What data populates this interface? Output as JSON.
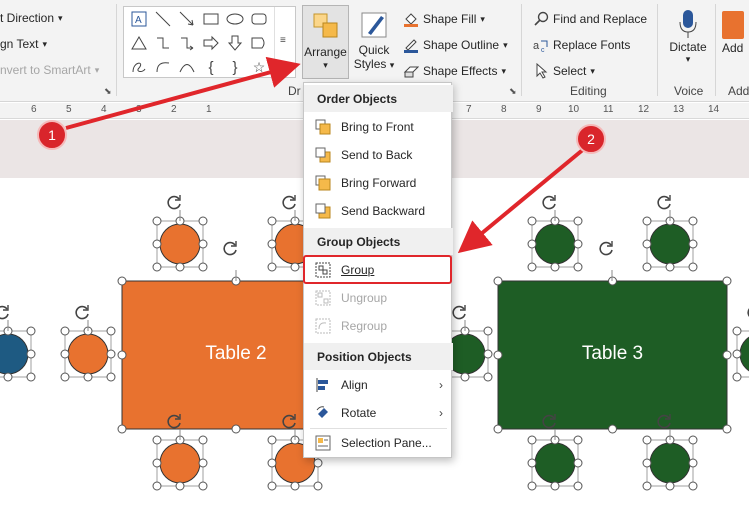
{
  "ribbon": {
    "text_direction": "t Direction",
    "align_text": "gn Text",
    "convert_smartart": "nvert to SmartArt",
    "drawing_group": "Dr",
    "arrange_label": "Arrange",
    "quick_styles_1": "Quick",
    "quick_styles_2": "Styles",
    "shape_fill": "Shape Fill",
    "shape_outline": "Shape Outline",
    "shape_effects": "Shape Effects",
    "find_replace": "Find and Replace",
    "replace_fonts": "Replace Fonts",
    "select": "Select",
    "editing_group": "Editing",
    "dictate": "Dictate",
    "voice_group": "Voice",
    "add_label": "Add",
    "add_group": "Add"
  },
  "ruler": {
    "numbers": [
      "6",
      "5",
      "4",
      "3",
      "2",
      "1",
      "7",
      "8",
      "9",
      "10",
      "11",
      "12",
      "13",
      "14"
    ]
  },
  "slide": {
    "table2_label": "Table 2",
    "table3_label": "Table 3",
    "table2_color": "#e8722f",
    "table3_color": "#1e5d25",
    "chair_blue": "#1e5a82"
  },
  "menu": {
    "order_heading": "Order Objects",
    "bring_to_front": "Bring to Front",
    "send_to_back": "Send to Back",
    "bring_forward": "Bring Forward",
    "send_backward": "Send Backward",
    "group_heading": "Group Objects",
    "group": "Group",
    "ungroup": "Ungroup",
    "regroup": "Regroup",
    "position_heading": "Position Objects",
    "align": "Align",
    "rotate": "Rotate",
    "selection_pane": "Selection Pane..."
  },
  "annotations": {
    "badge1": "1",
    "badge2": "2",
    "accent": "#d9252b"
  }
}
